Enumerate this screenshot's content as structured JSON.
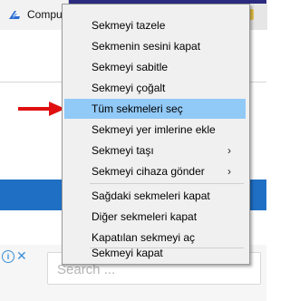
{
  "tab": {
    "title": "Compu"
  },
  "menu": {
    "items": [
      {
        "label": "Sekmeyi tazele"
      },
      {
        "label": "Sekmenin sesini kapat"
      },
      {
        "label": "Sekmeyi sabitle"
      },
      {
        "label": "Sekmeyi çoğalt"
      },
      {
        "label": "Tüm sekmeleri seç"
      },
      {
        "label": "Sekmeyi yer imlerine ekle"
      },
      {
        "label": "Sekmeyi taşı"
      },
      {
        "label": "Sekmeyi cihaza gönder"
      },
      {
        "label": "Sağdaki sekmeleri kapat"
      },
      {
        "label": "Diğer sekmeleri kapat"
      },
      {
        "label": "Kapatılan sekmeyi aç"
      },
      {
        "label": "Sekmeyi kapat"
      }
    ],
    "submenu_glyph": "›"
  },
  "ad": {
    "info_glyph": "i",
    "close_glyph": "✕"
  },
  "search": {
    "placeholder": "Search ..."
  },
  "colors": {
    "tabstrip": "#2c2b80",
    "highlight": "#91c9f7",
    "band": "#1f6fc4",
    "arrow": "#e01010"
  }
}
